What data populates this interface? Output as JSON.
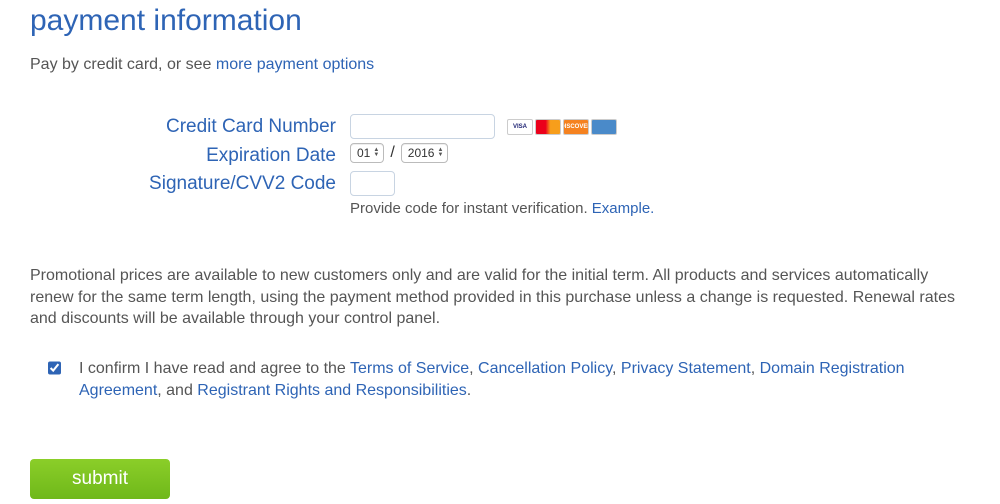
{
  "title": "payment information",
  "intro_prefix": "Pay by credit card, or see ",
  "intro_link": "more payment options",
  "fields": {
    "cc_label": "Credit Card Number",
    "cc_value": "",
    "exp_label": "Expiration Date",
    "exp_month": "01",
    "exp_year": "2016",
    "cvv_label": "Signature/CVV2 Code",
    "cvv_value": "",
    "cvv_hint_prefix": "Provide code for instant verification. ",
    "cvv_hint_link": "Example."
  },
  "cards": {
    "visa": "VISA",
    "mc": "",
    "disc": "DISCOVER",
    "amex": ""
  },
  "promo": "Promotional prices are available to new customers only and are valid for the initial term. All products and services automatically renew for the same term length, using the payment method provided in this purchase unless a change is requested. Renewal rates and discounts will be available through your control panel.",
  "consent": {
    "checked": true,
    "prefix": "I confirm I have read and agree to the ",
    "tos": "Terms of Service",
    "cancel": "Cancellation Policy",
    "privacy": "Privacy Statement",
    "domain": "Domain Registration Agreement",
    "mid": ", and ",
    "registrant": "Registrant Rights and Responsibilities",
    "period": "."
  },
  "submit_label": "submit"
}
